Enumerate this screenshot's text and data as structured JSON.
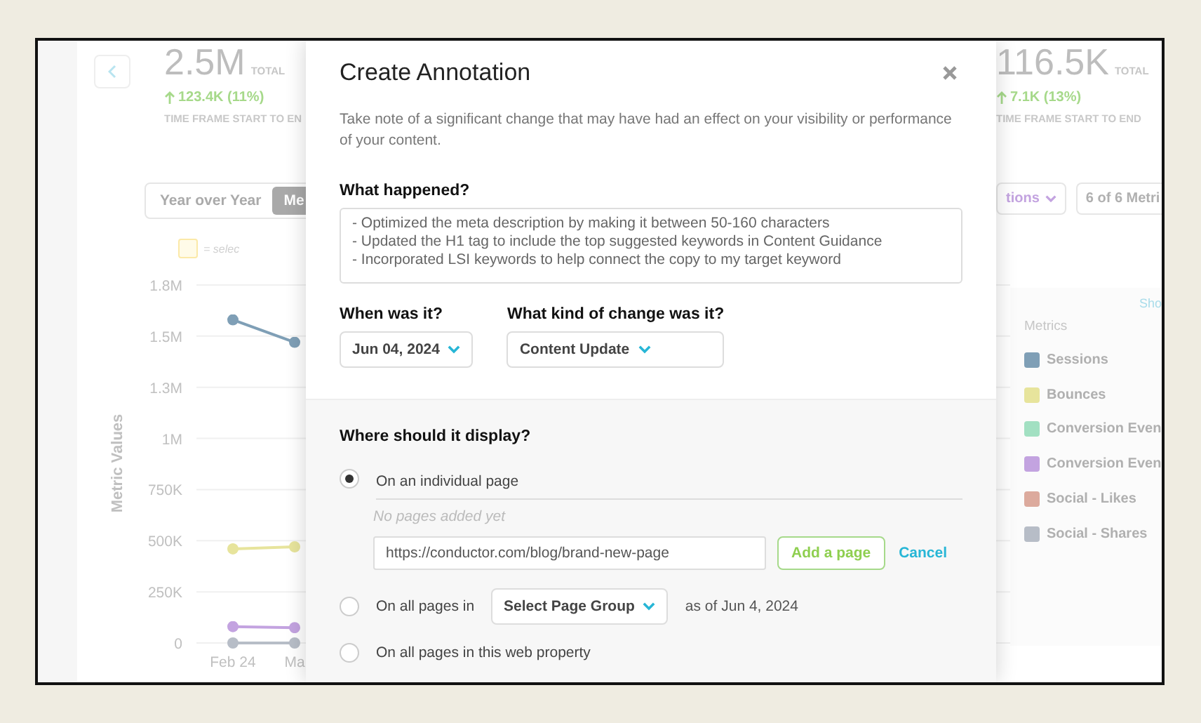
{
  "stats": [
    {
      "value": "2.5M",
      "unit": "TOTAL",
      "change": "123.4K (11%)",
      "caption": "TIME FRAME START TO EN"
    },
    {
      "value": "116.5K",
      "unit": "TOTAL",
      "change": "7.1K (13%)",
      "caption": "TIME FRAME START TO END"
    }
  ],
  "view_toggle": [
    {
      "label": "Year over Year",
      "selected": false
    },
    {
      "label": "Me",
      "selected": true
    }
  ],
  "dimensions_dropdown": {
    "label": "tions"
  },
  "metrics_dropdown": {
    "label": "6 of 6 Metri"
  },
  "selection_hint": {
    "text": "= selec"
  },
  "chart": {
    "chart_data": {
      "type": "line",
      "grid": true,
      "ylabel": "Metric Values",
      "categories": [
        "Feb 24",
        "Ma"
      ],
      "ylim": [
        0,
        1750000
      ],
      "yticks": [
        0,
        {
          "value": 250000,
          "label": "250K"
        },
        {
          "value": 500000,
          "label": "500K"
        },
        {
          "value": 750000,
          "label": "750K"
        },
        {
          "value": 1000000,
          "label": "1M"
        },
        {
          "value": 1250000,
          "label": "1.3M"
        },
        {
          "value": 1500000,
          "label": "1.5M"
        },
        {
          "value": 1750000,
          "label": "1.8M"
        }
      ],
      "series": [
        {
          "color": "#7f9fb6",
          "marker": true,
          "values": [
            1580000,
            1470000
          ]
        },
        {
          "color": "#e7e49c",
          "marker": true,
          "values": [
            460000,
            470000
          ]
        },
        {
          "color": "#c3a3e0",
          "marker": true,
          "values": [
            80000,
            75000
          ]
        },
        {
          "color": "#b7bdc7",
          "marker": true,
          "values": [
            0,
            0
          ]
        }
      ]
    }
  },
  "legend": {
    "link": "Sho",
    "title": "Metrics",
    "items": [
      {
        "label": "Sessions",
        "color": "#7f9fb6"
      },
      {
        "label": "Bounces",
        "color": "#e7e49c"
      },
      {
        "label": "Conversion Even",
        "color": "#a2e0c2"
      },
      {
        "label": "Conversion Even",
        "color": "#c3a3e0"
      },
      {
        "label": "Social - Likes",
        "color": "#dcaa9d"
      },
      {
        "label": "Social - Shares",
        "color": "#b7bdc7"
      }
    ]
  },
  "modal": {
    "title": "Create Annotation",
    "description": "Take note of a significant change that may have had an effect on your visibility or performance of your content.",
    "what_label": "What happened?",
    "what_value": "- Optimized the meta description by making it between 50-160 characters\n- Updated the H1 tag to include the top suggested keywords in Content Guidance\n- Incorporated LSI keywords to help connect the copy to my target keyword",
    "when_label": "When was it?",
    "date": "Jun 04, 2024",
    "kind_label": "What kind of change was it?",
    "kind_value": "Content Update",
    "display_label": "Where should it display?",
    "options": [
      {
        "kind": "individual",
        "label": "On an individual page",
        "selected": true,
        "empty_note": "No pages added yet",
        "url": "https://conductor.com/blog/brand-new-page",
        "add_button": "Add a page",
        "cancel": "Cancel"
      },
      {
        "kind": "group",
        "label": "On all pages in",
        "selected": false,
        "select": "Select Page Group",
        "suffix": "as of Jun 4, 2024"
      },
      {
        "kind": "property",
        "label": "On all pages in this web property",
        "selected": false
      }
    ]
  }
}
